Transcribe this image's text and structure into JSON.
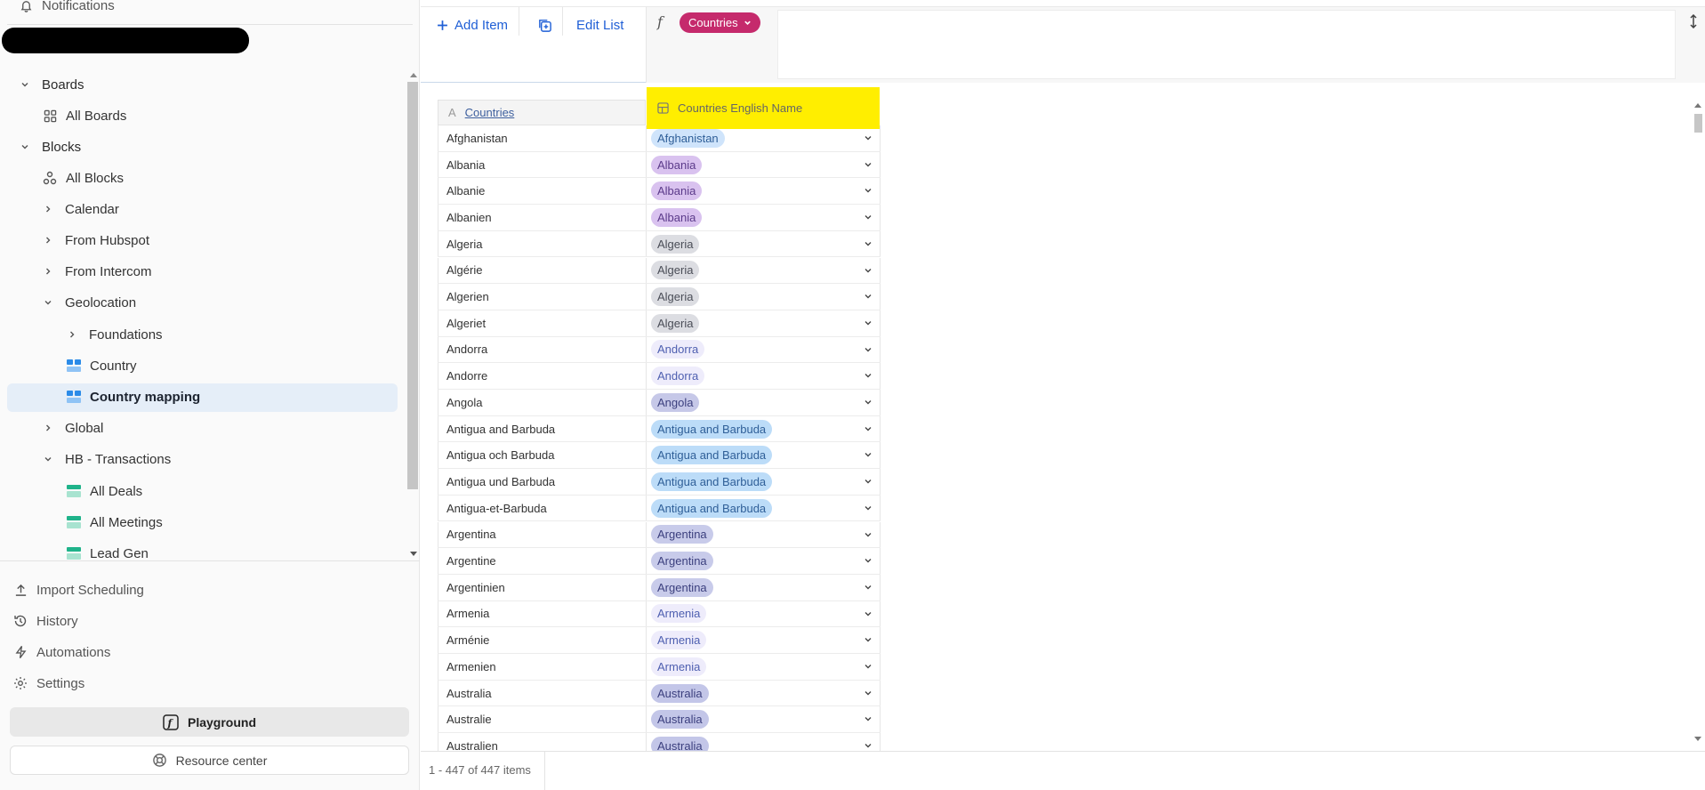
{
  "sidebar": {
    "notifications": "Notifications",
    "tree": [
      {
        "label": "Boards",
        "level": 0,
        "chevron": "down",
        "icon": null
      },
      {
        "label": "All Boards",
        "level": 1,
        "chevron": null,
        "icon": "grid-icon"
      },
      {
        "label": "Blocks",
        "level": 0,
        "chevron": "down",
        "icon": null
      },
      {
        "label": "All Blocks",
        "level": 1,
        "chevron": null,
        "icon": "blocks-icon"
      },
      {
        "label": "Calendar",
        "level": 1,
        "chevron": "right",
        "icon": null
      },
      {
        "label": "From Hubspot",
        "level": 1,
        "chevron": "right",
        "icon": null
      },
      {
        "label": "From Intercom",
        "level": 1,
        "chevron": "right",
        "icon": null
      },
      {
        "label": "Geolocation",
        "level": 1,
        "chevron": "down",
        "icon": null
      },
      {
        "label": "Foundations",
        "level": 2,
        "chevron": "right",
        "icon": null
      },
      {
        "label": "Country",
        "level": 2,
        "chevron": null,
        "icon": "board-blue-icon"
      },
      {
        "label": "Country mapping",
        "level": 2,
        "chevron": null,
        "icon": "board-blue-icon",
        "selected": true
      },
      {
        "label": "Global",
        "level": 1,
        "chevron": "right",
        "icon": null
      },
      {
        "label": "HB - Transactions",
        "level": 1,
        "chevron": "down",
        "icon": null
      },
      {
        "label": "All Deals",
        "level": 2,
        "chevron": null,
        "icon": "table-green-icon"
      },
      {
        "label": "All Meetings",
        "level": 2,
        "chevron": null,
        "icon": "table-green-icon"
      },
      {
        "label": "Lead Gen",
        "level": 2,
        "chevron": null,
        "icon": "table-green-icon"
      }
    ],
    "bottom": [
      {
        "label": "Import Scheduling",
        "icon": "upload-icon"
      },
      {
        "label": "History",
        "icon": "history-icon"
      },
      {
        "label": "Automations",
        "icon": "bolt-icon"
      },
      {
        "label": "Settings",
        "icon": "gear-icon"
      }
    ],
    "playground": "Playground",
    "resource_center": "Resource center"
  },
  "toolbar": {
    "add_item": "Add Item",
    "edit_list": "Edit List",
    "formula_chip": "Countries"
  },
  "grid": {
    "columns": [
      "Countries",
      "Countries English Name"
    ],
    "rows": [
      {
        "name": "Afghanistan",
        "english": "Afghanistan",
        "color": "#cfe4fb",
        "text": "#2f5f98"
      },
      {
        "name": "Albania",
        "english": "Albania",
        "color": "#d9c2ef",
        "text": "#5b3a8a"
      },
      {
        "name": "Albanie",
        "english": "Albania",
        "color": "#d9c2ef",
        "text": "#5b3a8a"
      },
      {
        "name": "Albanien",
        "english": "Albania",
        "color": "#d9c2ef",
        "text": "#5b3a8a"
      },
      {
        "name": "Algeria",
        "english": "Algeria",
        "color": "#dcdde2",
        "text": "#4a4d57"
      },
      {
        "name": "Algérie",
        "english": "Algeria",
        "color": "#dcdde2",
        "text": "#4a4d57"
      },
      {
        "name": "Algerien",
        "english": "Algeria",
        "color": "#dcdde2",
        "text": "#4a4d57"
      },
      {
        "name": "Algeriet",
        "english": "Algeria",
        "color": "#dcdde2",
        "text": "#4a4d57"
      },
      {
        "name": "Andorra",
        "english": "Andorra",
        "color": "#eeecfb",
        "text": "#4e5fb0"
      },
      {
        "name": "Andorre",
        "english": "Andorra",
        "color": "#eeecfb",
        "text": "#4e5fb0"
      },
      {
        "name": "Angola",
        "english": "Angola",
        "color": "#c6c8e8",
        "text": "#3b3f7e"
      },
      {
        "name": "Antigua and Barbuda",
        "english": "Antigua and Barbuda",
        "color": "#bcdcf8",
        "text": "#2f5f98"
      },
      {
        "name": "Antigua och Barbuda",
        "english": "Antigua and Barbuda",
        "color": "#bcdcf8",
        "text": "#2f5f98"
      },
      {
        "name": "Antigua und Barbuda",
        "english": "Antigua and Barbuda",
        "color": "#bcdcf8",
        "text": "#2f5f98"
      },
      {
        "name": "Antigua-et-Barbuda",
        "english": "Antigua and Barbuda",
        "color": "#bcdcf8",
        "text": "#2f5f98"
      },
      {
        "name": "Argentina",
        "english": "Argentina",
        "color": "#c8cbea",
        "text": "#3b3f7e"
      },
      {
        "name": "Argentine",
        "english": "Argentina",
        "color": "#c8cbea",
        "text": "#3b3f7e"
      },
      {
        "name": "Argentinien",
        "english": "Argentina",
        "color": "#c8cbea",
        "text": "#3b3f7e"
      },
      {
        "name": "Armenia",
        "english": "Armenia",
        "color": "#eeecfb",
        "text": "#4e5fb0"
      },
      {
        "name": "Arménie",
        "english": "Armenia",
        "color": "#eeecfb",
        "text": "#4e5fb0"
      },
      {
        "name": "Armenien",
        "english": "Armenia",
        "color": "#eeecfb",
        "text": "#4e5fb0"
      },
      {
        "name": "Australia",
        "english": "Australia",
        "color": "#c3c6e8",
        "text": "#3b3f7e"
      },
      {
        "name": "Australie",
        "english": "Australia",
        "color": "#c3c6e8",
        "text": "#3b3f7e"
      },
      {
        "name": "Australien",
        "english": "Australia",
        "color": "#c3c6e8",
        "text": "#3b3f7e"
      }
    ]
  },
  "footer": {
    "count": "1 - 447 of 447 items"
  }
}
